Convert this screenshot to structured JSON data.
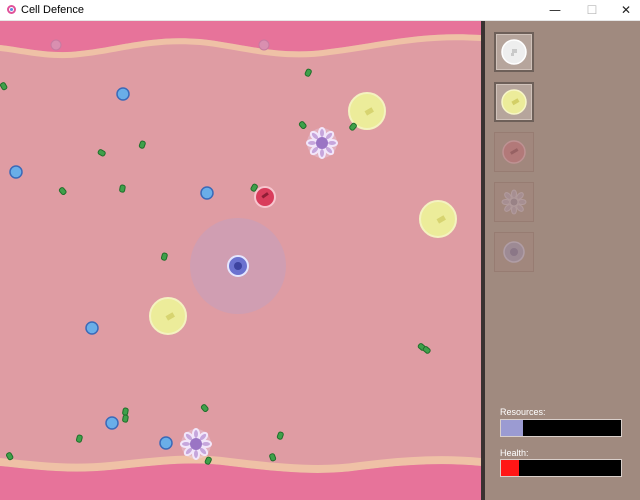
{
  "window": {
    "title": "Cell Defence",
    "controls": {
      "minimize": "—",
      "maximize": "☐",
      "close": "✕"
    }
  },
  "colors": {
    "plasma": "#df9ca3",
    "vessel_wall": "#e7739a",
    "vessel_edge": "#efc1a6",
    "panel": "#a08a7f",
    "resources_fill": "#9b9bd2",
    "health_fill": "#ff1616"
  },
  "towers": [
    {
      "name": "white-cell",
      "state": "active"
    },
    {
      "name": "yellow-cell",
      "state": "active"
    },
    {
      "name": "red-cell",
      "state": "locked"
    },
    {
      "name": "flower-cell",
      "state": "locked"
    },
    {
      "name": "purple-cell",
      "state": "locked"
    }
  ],
  "hud": {
    "resources_label": "Resources:",
    "resources_level": 0.18,
    "health_label": "Health:",
    "health_level": 0.15
  }
}
